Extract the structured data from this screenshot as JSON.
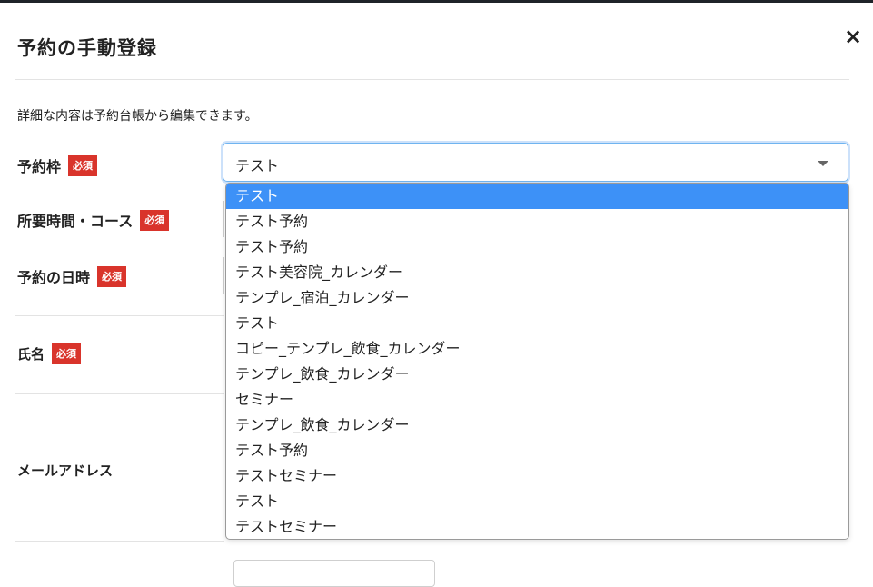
{
  "modal": {
    "title": "予約の手動登録",
    "close_icon": "×",
    "description": "詳細な内容は予約台帳から編集できます。"
  },
  "fields": {
    "slot": {
      "label": "予約枠",
      "badge": "必須",
      "value": "テスト"
    },
    "course": {
      "label": "所要時間・コース",
      "badge": "必須"
    },
    "datetime": {
      "label": "予約の日時",
      "badge": "必須"
    },
    "name": {
      "label": "氏名",
      "badge": "必須"
    },
    "email": {
      "label": "メールアドレス"
    }
  },
  "dropdown": {
    "options": [
      "テスト",
      "テスト予約",
      "テスト予約",
      "テスト美容院_カレンダー",
      "テンプレ_宿泊_カレンダー",
      "テスト",
      "コピー_テンプレ_飲食_カレンダー",
      "テンプレ_飲食_カレンダー",
      "セミナー",
      "テンプレ_飲食_カレンダー",
      "テスト予約",
      "テストセミナー",
      "テスト",
      "テストセミナー"
    ],
    "selected_index": 0
  },
  "colors": {
    "badge": "#d9342b",
    "highlight": "#3d91f7",
    "focus_border": "#6fb4f0"
  }
}
